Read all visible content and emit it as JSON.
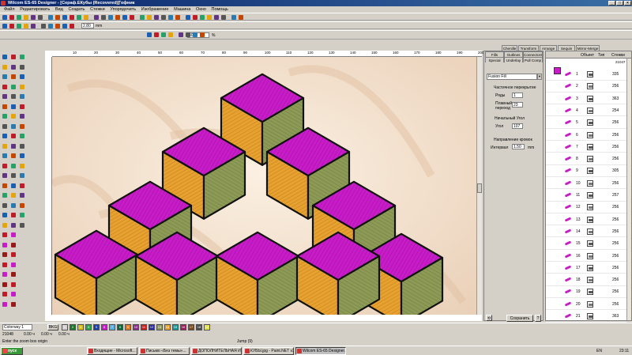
{
  "window": {
    "title": "Wilcom ES-65 Designer - [Сераф.ЕКубы (Recovered)]",
    "tab": "Гофник",
    "controls": [
      "_",
      "□",
      "×"
    ]
  },
  "menu": [
    "Файл",
    "Редактировать",
    "Вид",
    "Создать",
    "Стежки",
    "Упорядочить",
    "Изображение",
    "Машина",
    "Окно",
    "Помощь"
  ],
  "toolbar": {
    "width_value": "2.80",
    "width_unit": "mm",
    "zoom_value": "405",
    "zoom_unit": "%"
  },
  "canvas": {
    "ruler_marks": [
      "10",
      "20",
      "30",
      "40",
      "50",
      "60",
      "70",
      "80",
      "90",
      "100",
      "110",
      "120",
      "130",
      "140",
      "150",
      "160",
      "170",
      "180",
      "190",
      "200"
    ],
    "colors": {
      "magenta": "#c81cc8",
      "olive": "#8c9a56",
      "orange": "#e7a130",
      "outline": "#111111",
      "background": "#f3e3d3"
    }
  },
  "properties": {
    "tabs_top": [
      "Fills",
      "Outlines",
      "Connectors"
    ],
    "tabs_bottom": [
      "Special",
      "Underlay",
      "Pull Comp"
    ],
    "fill_type": "Fusion Fill",
    "section_partial": "Частичное перекрытие",
    "rows_label": "Ряды",
    "rows_value": "1",
    "smooth_label": "Плавный переход",
    "smooth_value": "23",
    "angle_section": "Начальный Угол",
    "angle_label": "Угол",
    "angle_value": "107",
    "direction_section": "Направление кромок",
    "spacing_label": "Интервал",
    "spacing_value": "1.50",
    "spacing_unit": "mm",
    "save_label": "Сохранить"
  },
  "right_tabs": [
    "Chenille",
    "Transform",
    "Arrange",
    "Sequin",
    "Mirror-Merge"
  ],
  "sequence": {
    "headers": [
      "",
      "Объект",
      "Тип",
      "Стежки"
    ],
    "total": "21047",
    "rows": [
      {
        "num": "1",
        "stitches": "335"
      },
      {
        "num": "2",
        "stitches": "256"
      },
      {
        "num": "3",
        "stitches": "363"
      },
      {
        "num": "4",
        "stitches": "254"
      },
      {
        "num": "5",
        "stitches": "256"
      },
      {
        "num": "6",
        "stitches": "256"
      },
      {
        "num": "7",
        "stitches": "256"
      },
      {
        "num": "8",
        "stitches": "256"
      },
      {
        "num": "9",
        "stitches": "305"
      },
      {
        "num": "10",
        "stitches": "256"
      },
      {
        "num": "11",
        "stitches": "257"
      },
      {
        "num": "12",
        "stitches": "256"
      },
      {
        "num": "13",
        "stitches": "256"
      },
      {
        "num": "14",
        "stitches": "256"
      },
      {
        "num": "15",
        "stitches": "256"
      },
      {
        "num": "16",
        "stitches": "256"
      },
      {
        "num": "17",
        "stitches": "256"
      },
      {
        "num": "18",
        "stitches": "256"
      },
      {
        "num": "19",
        "stitches": "256"
      },
      {
        "num": "20",
        "stitches": "256"
      },
      {
        "num": "21",
        "stitches": "363"
      }
    ]
  },
  "bottom": {
    "colorway": "Colorway 1",
    "bkg": "BKG",
    "swatches": [
      {
        "label": "1",
        "color": "#d3d3d3"
      },
      {
        "label": "2",
        "color": "#1a7a2a"
      },
      {
        "label": "3",
        "color": "#d8c21a"
      },
      {
        "label": "4",
        "color": "#2aa94a"
      },
      {
        "label": "5",
        "color": "#1f3fa8"
      },
      {
        "label": "6",
        "color": "#c81cc8"
      },
      {
        "label": "7",
        "color": "#5ab0e0"
      },
      {
        "label": "8",
        "color": "#0a6a3a"
      },
      {
        "label": "9",
        "color": "#e07a1a"
      },
      {
        "label": "10",
        "color": "#8a2a8a"
      },
      {
        "label": "11",
        "color": "#c81c1c"
      },
      {
        "label": "12",
        "color": "#2a2a9a"
      },
      {
        "label": "13",
        "color": "#8c9a56"
      },
      {
        "label": "14",
        "color": "#e7a130"
      },
      {
        "label": "15",
        "color": "#1a9a9a"
      },
      {
        "label": "16",
        "color": "#9a1a5a"
      },
      {
        "label": "17",
        "color": "#7a4a1a"
      },
      {
        "label": "18",
        "color": "#4a4a4a"
      },
      {
        "label": "19",
        "color": "#e0e040"
      }
    ]
  },
  "status": {
    "stitch_count": "21048",
    "x_value": "0.00 ч",
    "y_value": "0.00 ч",
    "w_value": "0.00 ч",
    "hint": "Enter the zoom box origin",
    "jump": "Jump (9)"
  },
  "taskbar": {
    "start": "пуск",
    "tasks": [
      "Входящие - Microsoft...",
      "Письмо «Без темы»...",
      "ДОПОЛНИТЕЛЬНАЯ ИНФ...",
      "КУБЫ.jpg - Paint.NET v3...",
      "Wilcom ES-65 Designer..."
    ],
    "lang": "EN",
    "clock": "23:11"
  }
}
